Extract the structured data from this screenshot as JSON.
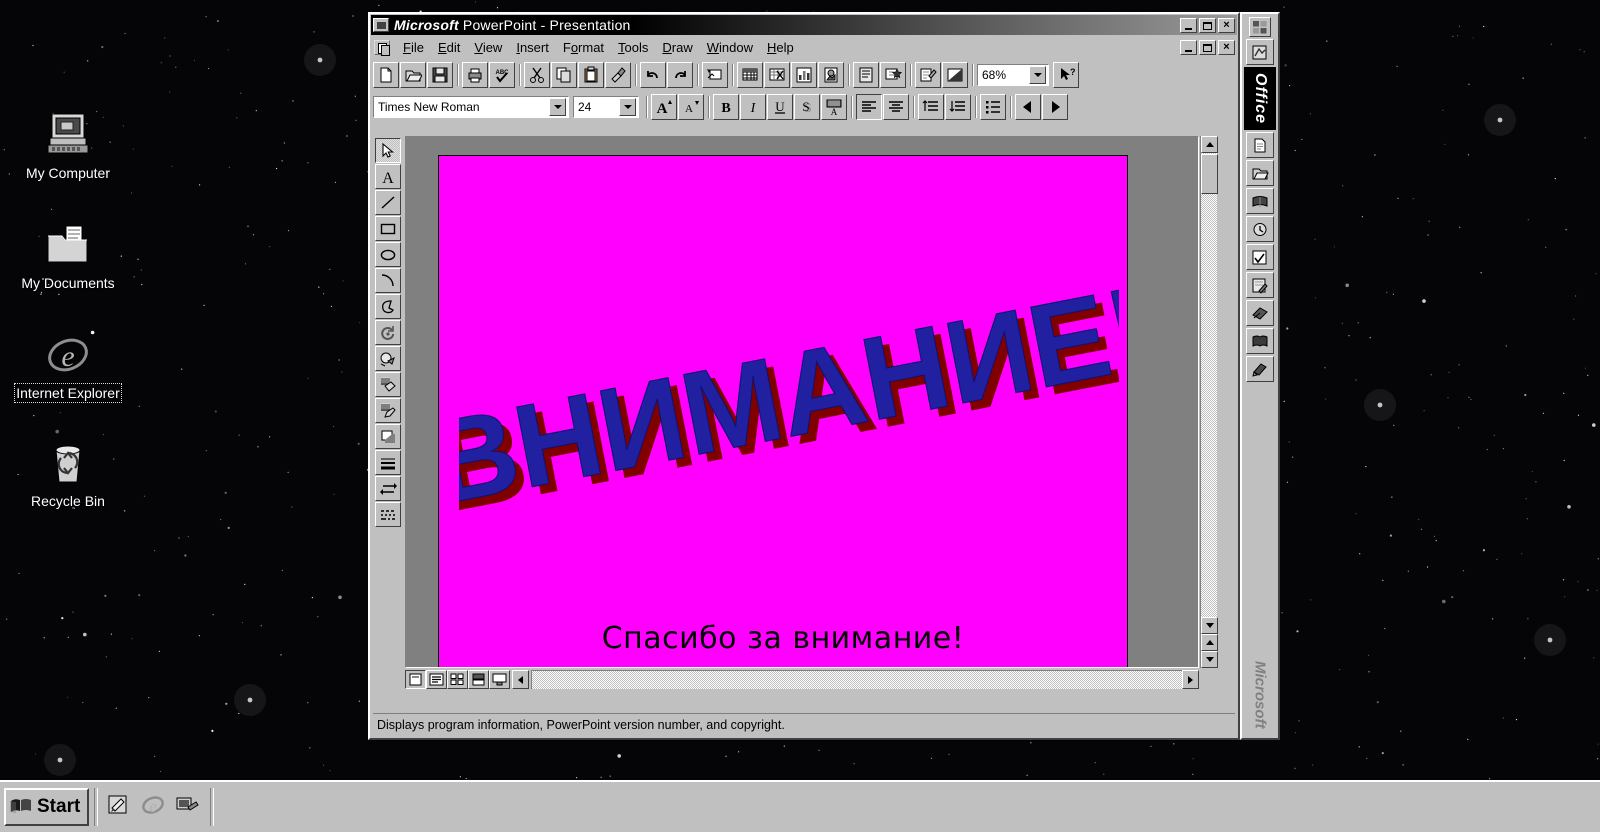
{
  "desktop": {
    "icons": [
      {
        "name": "my-computer",
        "label": "My Computer",
        "icon": "computer-icon",
        "selected": false
      },
      {
        "name": "my-documents",
        "label": "My Documents",
        "icon": "documents-folder-icon",
        "selected": false
      },
      {
        "name": "internet-explorer",
        "label": "Internet Explorer",
        "icon": "internet-explorer-icon",
        "selected": true
      },
      {
        "name": "recycle-bin",
        "label": "Recycle Bin",
        "icon": "recycle-bin-icon",
        "selected": false
      }
    ],
    "background_color": "#050507"
  },
  "window": {
    "title_brand": "Microsoft",
    "title_rest": " PowerPoint  -  Presentation",
    "system_menu_icon": "powerpoint-system-icon",
    "controls": [
      {
        "name": "minimize",
        "glyph": "_"
      },
      {
        "name": "restore",
        "glyph": "❐"
      },
      {
        "name": "close",
        "glyph": "×"
      }
    ],
    "doc_controls": [
      {
        "name": "doc-minimize",
        "glyph": "_"
      },
      {
        "name": "doc-restore",
        "glyph": "❐"
      },
      {
        "name": "doc-close",
        "glyph": "×"
      }
    ]
  },
  "menu": {
    "document_icon": "document-window-icon",
    "items": [
      {
        "label": "File",
        "accel": "F"
      },
      {
        "label": "Edit",
        "accel": "E"
      },
      {
        "label": "View",
        "accel": "V"
      },
      {
        "label": "Insert",
        "accel": "I"
      },
      {
        "label": "Format",
        "accel": "o"
      },
      {
        "label": "Tools",
        "accel": "T"
      },
      {
        "label": "Draw",
        "accel": "D"
      },
      {
        "label": "Window",
        "accel": "W"
      },
      {
        "label": "Help",
        "accel": "H"
      }
    ]
  },
  "standard_toolbar": {
    "buttons": [
      {
        "name": "new-file-button",
        "icon": "new-document-icon"
      },
      {
        "name": "open-file-button",
        "icon": "open-folder-icon"
      },
      {
        "name": "save-button",
        "icon": "floppy-disk-icon"
      },
      {
        "name": "print-button",
        "icon": "printer-icon"
      },
      {
        "name": "spelling-button",
        "icon": "spellcheck-abc-icon"
      },
      {
        "name": "cut-button",
        "icon": "scissors-icon"
      },
      {
        "name": "copy-button",
        "icon": "copy-pages-icon"
      },
      {
        "name": "paste-button",
        "icon": "clipboard-icon"
      },
      {
        "name": "format-painter-button",
        "icon": "paintbrush-icon"
      },
      {
        "name": "undo-button",
        "icon": "undo-arrow-icon"
      },
      {
        "name": "redo-button",
        "icon": "redo-arrow-icon"
      },
      {
        "name": "insert-new-slide-button",
        "icon": "new-slide-icon"
      },
      {
        "name": "insert-table-button",
        "icon": "table-grid-icon"
      },
      {
        "name": "insert-worksheet-button",
        "icon": "excel-worksheet-icon"
      },
      {
        "name": "insert-chart-button",
        "icon": "bar-chart-icon"
      },
      {
        "name": "insert-clipart-button",
        "icon": "clip-art-icon"
      },
      {
        "name": "insert-outline-button",
        "icon": "outline-icon"
      },
      {
        "name": "pick-a-look-button",
        "icon": "pick-a-look-star-icon"
      },
      {
        "name": "apply-template-button",
        "icon": "apply-template-icon"
      },
      {
        "name": "black-white-button",
        "icon": "black-and-white-icon"
      }
    ],
    "zoom": {
      "value": "68%",
      "name": "zoom-combo"
    },
    "help_button": {
      "name": "help-pointer-button",
      "icon": "arrow-question-icon"
    }
  },
  "formatting_toolbar": {
    "font": {
      "value": "Times New Roman",
      "name": "font-name-combo"
    },
    "size": {
      "value": "24",
      "name": "font-size-combo"
    },
    "buttons": [
      {
        "name": "increase-font-size-button",
        "icon": "big-a-up-icon",
        "glyph": "A"
      },
      {
        "name": "decrease-font-size-button",
        "icon": "small-a-down-icon",
        "glyph": "A"
      },
      {
        "name": "bold-button",
        "icon": "bold-icon",
        "glyph": "B"
      },
      {
        "name": "italic-button",
        "icon": "italic-icon",
        "glyph": "I"
      },
      {
        "name": "underline-button",
        "icon": "underline-icon",
        "glyph": "U"
      },
      {
        "name": "shadow-button",
        "icon": "text-shadow-icon",
        "glyph": "S"
      },
      {
        "name": "text-color-button",
        "icon": "text-color-icon",
        "glyph": "A"
      },
      {
        "name": "align-left-button",
        "icon": "align-left-icon",
        "glyph": ""
      },
      {
        "name": "align-center-button",
        "icon": "align-center-icon",
        "glyph": ""
      },
      {
        "name": "decrease-paragraph-spacing-button",
        "icon": "line-spacing-down-icon",
        "glyph": ""
      },
      {
        "name": "increase-paragraph-spacing-button",
        "icon": "line-spacing-up-icon",
        "glyph": ""
      },
      {
        "name": "bullet-list-button",
        "icon": "bullet-list-icon",
        "glyph": ""
      },
      {
        "name": "promote-button",
        "icon": "left-arrow-icon",
        "glyph": ""
      },
      {
        "name": "demote-button",
        "icon": "right-arrow-icon",
        "glyph": ""
      }
    ]
  },
  "drawing_toolbar": {
    "buttons": [
      {
        "name": "select-tool",
        "icon": "arrow-pointer-icon",
        "active": true
      },
      {
        "name": "text-tool",
        "icon": "text-a-icon",
        "active": false
      },
      {
        "name": "line-tool",
        "icon": "line-icon",
        "active": false
      },
      {
        "name": "rectangle-tool",
        "icon": "rectangle-icon",
        "active": false
      },
      {
        "name": "ellipse-tool",
        "icon": "ellipse-icon",
        "active": false
      },
      {
        "name": "arc-tool",
        "icon": "arc-icon",
        "active": false
      },
      {
        "name": "freeform-tool",
        "icon": "freeform-shape-icon",
        "active": false
      },
      {
        "name": "free-rotate-tool",
        "icon": "rotate-icon",
        "active": false
      },
      {
        "name": "autoshapes-tool",
        "icon": "autoshapes-icon",
        "active": false
      },
      {
        "name": "fill-color-tool",
        "icon": "fill-bucket-icon",
        "active": false
      },
      {
        "name": "line-color-tool",
        "icon": "pencil-line-icon",
        "active": false
      },
      {
        "name": "shadow-tool",
        "icon": "shadow-box-icon",
        "active": false
      },
      {
        "name": "line-style-tool",
        "icon": "line-style-icon",
        "active": false
      },
      {
        "name": "arrowheads-tool",
        "icon": "arrowheads-icon",
        "active": false
      },
      {
        "name": "dash-style-tool",
        "icon": "dash-style-icon",
        "active": false
      }
    ]
  },
  "slide": {
    "background_color": "#ff00ff",
    "wordart": {
      "text": "ВНИМАНИЕ!",
      "fill_color": "#2020a0",
      "shadow_color": "#800000",
      "rotation_deg": -11
    },
    "subtitle": {
      "text": "Спасибо за внимание!",
      "color": "#000000"
    }
  },
  "view_buttons": [
    {
      "name": "slide-view-button",
      "icon": "slide-view-icon",
      "active": true
    },
    {
      "name": "outline-view-button",
      "icon": "outline-view-icon",
      "active": false
    },
    {
      "name": "slide-sorter-view-button",
      "icon": "sorter-view-icon",
      "active": false
    },
    {
      "name": "notes-pages-view-button",
      "icon": "notes-view-icon",
      "active": false
    },
    {
      "name": "slide-show-button",
      "icon": "slide-show-icon",
      "active": false
    }
  ],
  "status_bar": {
    "message": "Displays program information, PowerPoint version number, and copyright."
  },
  "office_bar": {
    "title": "Office",
    "footer": "Microsoft",
    "handle_icon": "office-handle-icon",
    "buttons": [
      {
        "name": "office-start-using-button",
        "icon": "office-logo-icon"
      },
      {
        "name": "new-office-document-button",
        "icon": "new-doc-icon"
      },
      {
        "name": "open-office-document-button",
        "icon": "open-doc-icon"
      },
      {
        "name": "schedule-button",
        "icon": "calendar-book-icon"
      },
      {
        "name": "contacts-button",
        "icon": "contacts-clock-icon"
      },
      {
        "name": "tasks-button",
        "icon": "checklist-icon"
      },
      {
        "name": "journal-button",
        "icon": "journal-pen-icon"
      },
      {
        "name": "notes-button",
        "icon": "sticky-notes-icon"
      },
      {
        "name": "getting-results-button",
        "icon": "book-icon"
      },
      {
        "name": "answer-wizard-button",
        "icon": "answer-wizard-icon"
      }
    ]
  },
  "taskbar": {
    "start_label": "Start",
    "start_icon": "windows-flag-icon",
    "quick_launch": [
      {
        "name": "quicklaunch-notepad",
        "icon": "notepad-pencil-icon"
      },
      {
        "name": "quicklaunch-ie",
        "icon": "internet-explorer-e-icon"
      },
      {
        "name": "quicklaunch-desktop",
        "icon": "show-desktop-icon"
      }
    ]
  }
}
